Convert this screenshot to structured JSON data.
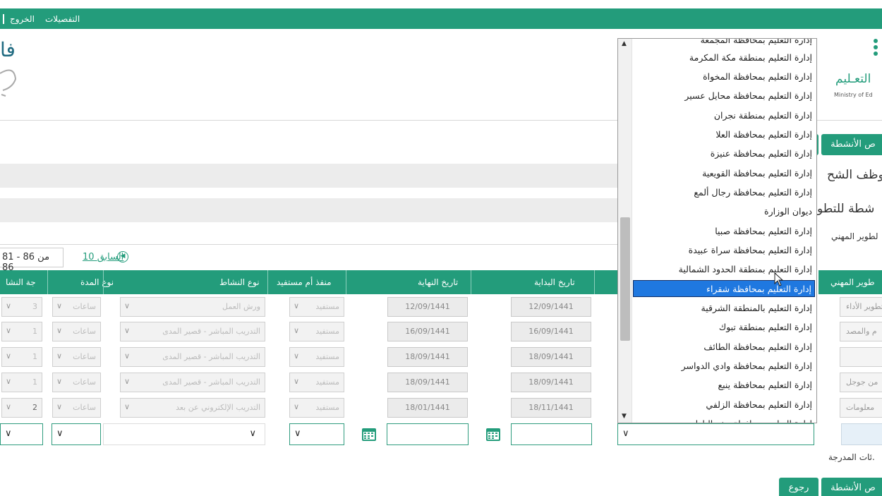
{
  "topbar": {
    "details": "التفصيلات",
    "logout": "الخروج"
  },
  "logo_right": {
    "word": "التعـليم",
    "sub": "Ministry of Ed"
  },
  "logo_left": {
    "glyph": "فا"
  },
  "buttons": {
    "activities_top": "ص الأنشطة",
    "activities_bottom": "ص الأنشطة",
    "back": "رجوع"
  },
  "section": {
    "employee": "موظف الشح",
    "activities": "شطة للتطو",
    "dev_label": "لطوير المهني"
  },
  "pager": {
    "range": "81 - 86 من 86",
    "prev": "10 السابق"
  },
  "table": {
    "headers": [
      "جة النشا",
      "نوع المدة",
      "نوع النشاط",
      "منفذ أم مستفيد",
      "تاريخ النهاية",
      "تاريخ البداية"
    ],
    "right_header": "طوير المهني",
    "rows": [
      {
        "score": "3",
        "duration_type": "ساعات",
        "activity_type": "ورش العمل",
        "role": "مستفيد",
        "end": "12/09/1441",
        "start": "12/09/1441",
        "right": "تطوير الأداء"
      },
      {
        "score": "1",
        "duration_type": "ساعات",
        "activity_type": "التدريب المباشر - قصير المدى",
        "role": "مستفيد",
        "end": "16/09/1441",
        "start": "16/09/1441",
        "right": "م والمصد"
      },
      {
        "score": "1",
        "duration_type": "ساعات",
        "activity_type": "التدريب المباشر - قصير المدى",
        "role": "مستفيد",
        "end": "18/09/1441",
        "start": "18/09/1441",
        "right": ""
      },
      {
        "score": "1",
        "duration_type": "ساعات",
        "activity_type": "التدريب المباشر - قصير المدى",
        "role": "مستفيد",
        "end": "18/09/1441",
        "start": "18/09/1441",
        "right": "من جوجل"
      },
      {
        "score": "2",
        "duration_type": "ساعات",
        "activity_type": "التدريب الإلكتروني عن بعد",
        "role": "مستفيد",
        "end": "18/01/1441",
        "start": "18/11/1441",
        "right": "معلومات"
      }
    ]
  },
  "dropdown": {
    "options": [
      "إدارة التعليم بمحافظة المجمعة",
      "إدارة التعليم بمنطقة مكة المكرمة",
      "إدارة التعليم بمحافظة المخواة",
      "إدارة التعليم بمحافظة محايل عسير",
      "إدارة التعليم بمنطقة نجران",
      "إدارة التعليم بمحافظة العلا",
      "إدارة التعليم بمحافظة عنيزة",
      "إدارة التعليم بمحافظة القويعية",
      "إدارة التعليم بمحافظة رجال ألمع",
      "ديوان الوزارة",
      "إدارة التعليم بمحافظة صبيا",
      "إدارة التعليم بمحافظة سراة عبيدة",
      "إدارة التعليم بمنطقة الحدود الشمالية",
      "إدارة التعليم بمحافظة شقراء",
      "إدارة التعليم بالمنطقة الشرقية",
      "إدارة التعليم بمنطقة تبوك",
      "إدارة التعليم بمحافظة الطائف",
      "إدارة التعليم بمحافظة وادي الدواسر",
      "إدارة التعليم بمحافظة ينبع",
      "إدارة التعليم بمحافظة الزلفي",
      "إدارة التعليم بمحافظة حفر الباطن"
    ],
    "selected": "إدارة التعليم بمحافظة شقراء"
  },
  "note": "ئات المدرجة."
}
